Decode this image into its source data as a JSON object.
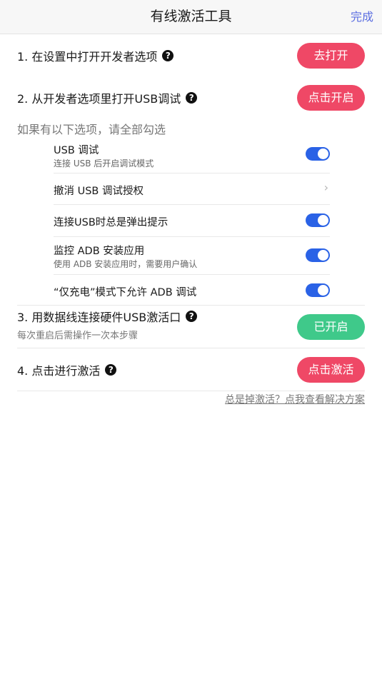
{
  "nav": {
    "title": "有线激活工具",
    "done": "完成"
  },
  "steps": [
    {
      "text": "1. 在设置中打开开发者选项",
      "button": "去打开"
    },
    {
      "text": "2. 从开发者选项里打开USB调试",
      "button": "点击开启"
    },
    {
      "text": "3. 用数据线连接硬件USB激活口",
      "sub": "每次重启后需操作一次本步骤",
      "button": "已开启"
    },
    {
      "text": "4. 点击进行激活",
      "button": "点击激活"
    }
  ],
  "help_glyph": "?",
  "options_hint": "如果有以下选项，请全部勾选",
  "options": [
    {
      "title": "USB 调试",
      "sub": "连接 USB 后开启调试模式",
      "toggle": true
    },
    {
      "title": "撤消 USB 调试授权",
      "chevron": "›"
    },
    {
      "title": "连接USB时总是弹出提示",
      "toggle": true
    },
    {
      "title": "监控 ADB 安装应用",
      "sub": "使用 ADB 安装应用时，需要用户确认",
      "toggle": true
    },
    {
      "title": "“仅充电”模式下允许 ADB 调试",
      "toggle": true
    }
  ],
  "footer_link": "总是掉激活？点我查看解决方案",
  "colors": {
    "accent_red": "#ef4866",
    "accent_green": "#3fc98a",
    "toggle_on": "#2a62e6",
    "link_blue": "#5b6ee1"
  }
}
